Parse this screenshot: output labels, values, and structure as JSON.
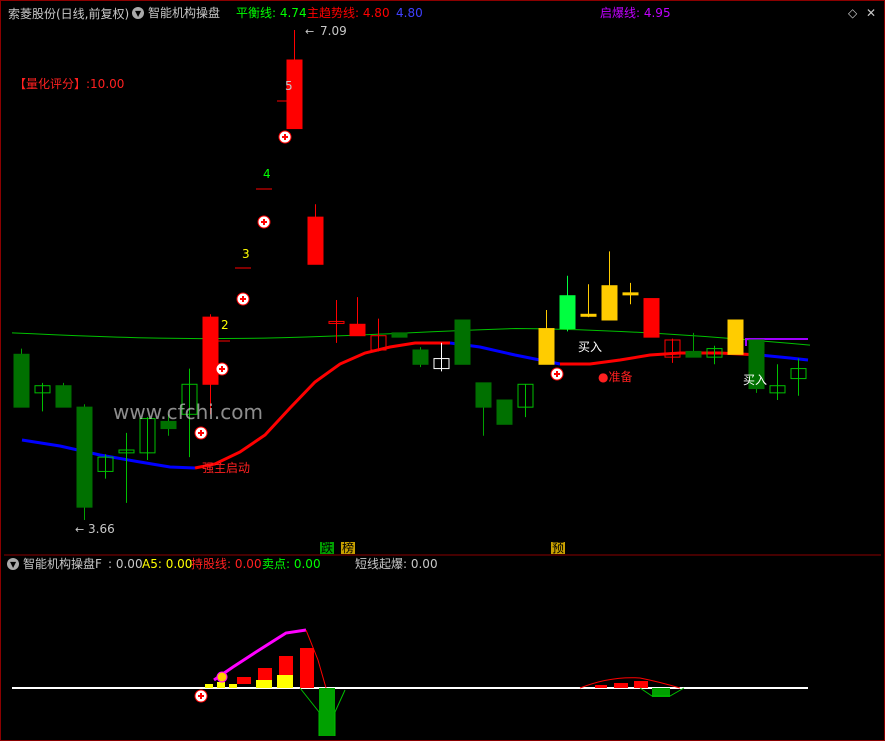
{
  "header": {
    "stock_title": "索菱股份(日线,前复权)",
    "indicator_name": "智能机构操盘",
    "balance_label": "平衡线: 4.74",
    "main_trend_label": "主趋势线: 4.80",
    "blue_value": "4.80",
    "ignite_label": "启爆线: 4.95"
  },
  "score_label": "【量化评分】:10.00",
  "watermark": "www.cfchi.com",
  "price_annotations": {
    "high": "7.09",
    "low": "3.66",
    "n2": "2",
    "n3": "3",
    "n4": "4",
    "n5": "5",
    "strong_start": "强主启动",
    "prepare": "●准备",
    "buy1": "买入",
    "buy2": "买入"
  },
  "bottom_tags": {
    "fall": "跌",
    "stop": "榜",
    "pre": "预"
  },
  "sub_header": {
    "name": "智能机构操盘F",
    "f_value": ": 0.00",
    "a5": "A5: 0.00",
    "hold": "持股线: 0.00",
    "sell": "卖点: 0.00",
    "short": "短线起爆: 0.00"
  },
  "colors": {
    "up": "#ff0000",
    "down": "#008000",
    "yellow": "#ffcc00",
    "blue": "#0000ff",
    "green_line": "#00c000",
    "magenta": "#ff00ff"
  },
  "chart_data": {
    "type": "candlestick",
    "title": "",
    "ylim": [
      3.5,
      7.3
    ],
    "candles": [
      {
        "o": 4.82,
        "h": 4.86,
        "l": 4.45,
        "c": 4.45,
        "col": "down"
      },
      {
        "o": 4.55,
        "h": 4.62,
        "l": 4.42,
        "c": 4.6,
        "col": "hollow_green"
      },
      {
        "o": 4.6,
        "h": 4.62,
        "l": 4.45,
        "c": 4.45,
        "col": "down"
      },
      {
        "o": 4.45,
        "h": 4.47,
        "l": 3.66,
        "c": 3.75,
        "col": "down"
      },
      {
        "o": 4.0,
        "h": 4.12,
        "l": 3.95,
        "c": 4.1,
        "col": "hollow_green"
      },
      {
        "o": 4.13,
        "h": 4.27,
        "l": 3.78,
        "c": 4.15,
        "col": "hollow_green"
      },
      {
        "o": 4.13,
        "h": 4.38,
        "l": 4.08,
        "c": 4.37,
        "col": "hollow_green"
      },
      {
        "o": 4.35,
        "h": 4.4,
        "l": 4.25,
        "c": 4.3,
        "col": "down"
      },
      {
        "o": 4.4,
        "h": 4.72,
        "l": 4.1,
        "c": 4.61,
        "col": "hollow_green"
      },
      {
        "o": 4.61,
        "h": 5.1,
        "l": 4.4,
        "c": 5.08,
        "col": "up"
      },
      {
        "o": 5.6,
        "h": 5.6,
        "l": 5.6,
        "c": 5.6,
        "col": "flat"
      },
      {
        "o": 6.15,
        "h": 6.15,
        "l": 6.15,
        "c": 6.15,
        "col": "flat"
      },
      {
        "o": 6.7,
        "h": 6.7,
        "l": 6.7,
        "c": 6.7,
        "col": "flat"
      },
      {
        "o": 6.4,
        "h": 7.09,
        "l": 6.4,
        "c": 6.88,
        "col": "up"
      },
      {
        "o": 5.78,
        "h": 5.87,
        "l": 5.45,
        "c": 5.45,
        "col": "up"
      },
      {
        "o": 5.05,
        "h": 5.2,
        "l": 4.9,
        "c": 5.05,
        "col": "hollow_red"
      },
      {
        "o": 4.95,
        "h": 5.22,
        "l": 4.95,
        "c": 5.03,
        "col": "up"
      },
      {
        "o": 4.95,
        "h": 5.07,
        "l": 4.84,
        "c": 4.85,
        "col": "hollow_red"
      },
      {
        "o": 4.97,
        "h": 4.97,
        "l": 4.94,
        "c": 4.94,
        "col": "down"
      },
      {
        "o": 4.85,
        "h": 4.87,
        "l": 4.73,
        "c": 4.75,
        "col": "down"
      },
      {
        "o": 4.72,
        "h": 4.9,
        "l": 4.7,
        "c": 4.79,
        "col": "hollow_white"
      },
      {
        "o": 5.06,
        "h": 5.06,
        "l": 4.75,
        "c": 4.75,
        "col": "down"
      },
      {
        "o": 4.62,
        "h": 4.62,
        "l": 4.25,
        "c": 4.45,
        "col": "down"
      },
      {
        "o": 4.5,
        "h": 4.5,
        "l": 4.33,
        "c": 4.33,
        "col": "down"
      },
      {
        "o": 4.45,
        "h": 4.61,
        "l": 4.38,
        "c": 4.61,
        "col": "hollow_green"
      },
      {
        "o": 4.75,
        "h": 5.13,
        "l": 4.75,
        "c": 5.0,
        "col": "yellow"
      },
      {
        "o": 5.0,
        "h": 5.37,
        "l": 4.98,
        "c": 5.23,
        "col": "lime"
      },
      {
        "o": 5.1,
        "h": 5.31,
        "l": 5.08,
        "c": 5.1,
        "col": "yellow"
      },
      {
        "o": 5.3,
        "h": 5.54,
        "l": 5.06,
        "c": 5.06,
        "col": "yellow"
      },
      {
        "o": 5.25,
        "h": 5.32,
        "l": 5.17,
        "c": 5.25,
        "col": "yellow"
      },
      {
        "o": 5.21,
        "h": 5.21,
        "l": 4.94,
        "c": 4.94,
        "col": "up"
      },
      {
        "o": 4.8,
        "h": 4.93,
        "l": 4.76,
        "c": 4.92,
        "col": "hollow_red"
      },
      {
        "o": 4.84,
        "h": 4.97,
        "l": 4.8,
        "c": 4.8,
        "col": "down"
      },
      {
        "o": 4.8,
        "h": 4.88,
        "l": 4.75,
        "c": 4.86,
        "col": "hollow_green"
      },
      {
        "o": 4.82,
        "h": 5.06,
        "l": 4.82,
        "c": 5.06,
        "col": "yellow"
      },
      {
        "o": 4.92,
        "h": 4.92,
        "l": 4.55,
        "c": 4.58,
        "col": "down"
      },
      {
        "o": 4.55,
        "h": 4.75,
        "l": 4.5,
        "c": 4.6,
        "col": "hollow_green"
      },
      {
        "o": 4.65,
        "h": 4.79,
        "l": 4.53,
        "c": 4.72,
        "col": "hollow_green"
      }
    ]
  }
}
